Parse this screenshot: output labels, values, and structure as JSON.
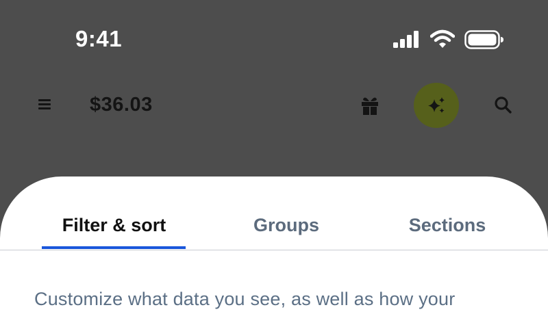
{
  "status_bar": {
    "time": "9:41",
    "icons": [
      "cellular-signal-icon",
      "wifi-icon",
      "battery-icon"
    ]
  },
  "header": {
    "balance": "$36.03",
    "icons": [
      "menu-icon",
      "gift-icon",
      "sparkles-icon",
      "search-icon"
    ],
    "ai_button_color": "#56601b"
  },
  "sheet": {
    "tabs": [
      {
        "label": "Filter & sort",
        "active": true
      },
      {
        "label": "Groups",
        "active": false
      },
      {
        "label": "Sections",
        "active": false
      }
    ],
    "description": "Customize what data you see, as well as how your"
  },
  "colors": {
    "backdrop": "#4d4d4d",
    "accent": "#1a56db",
    "muted_text": "#5b6f85"
  }
}
